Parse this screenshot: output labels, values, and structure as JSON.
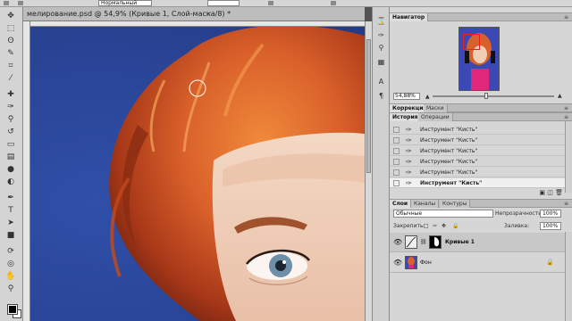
{
  "options_bar": {
    "mode_value": "Нормальный"
  },
  "document": {
    "tab_title": "мелирование.psd @ 54,9% (Кривые 1, Слой-маска/8) *",
    "close_glyph": "×"
  },
  "toolbar": {
    "tools": [
      "move-icon",
      "marquee-icon",
      "lasso-icon",
      "quick-select-icon",
      "crop-icon",
      "eyedropper-icon",
      "healing-icon",
      "brush-icon",
      "stamp-icon",
      "history-brush-icon",
      "eraser-icon",
      "gradient-icon",
      "blur-icon",
      "dodge-icon",
      "pen-icon",
      "type-icon",
      "path-select-icon",
      "shape-icon",
      "3d-rotate-icon",
      "3d-orbit-icon",
      "hand-icon",
      "zoom-icon"
    ],
    "fg_color": "#000000",
    "bg_color": "#ffffff"
  },
  "navigator": {
    "tab": "Навигатор",
    "zoom": "54,88%"
  },
  "adjustments": {
    "tabs": [
      "Коррекция",
      "Маски"
    ]
  },
  "history": {
    "tabs": [
      "История",
      "Операции"
    ],
    "items": [
      "Инструмент \"Кисть\"",
      "Инструмент \"Кисть\"",
      "Инструмент \"Кисть\"",
      "Инструмент \"Кисть\"",
      "Инструмент \"Кисть\"",
      "Инструмент \"Кисть\""
    ]
  },
  "layers": {
    "tabs": [
      "Слои",
      "Каналы",
      "Контуры"
    ],
    "blend_mode": "Обычные",
    "opacity_label": "Непрозрачность:",
    "opacity_value": "100%",
    "lock_label": "Закрепить:",
    "fill_label": "Заливка:",
    "fill_value": "100%",
    "items": [
      {
        "name": "Кривые 1"
      },
      {
        "name": "Фон"
      }
    ]
  },
  "colors": {
    "panel_bg": "#d6d6d6",
    "canvas_blue": "#2a4597",
    "hair": "#d9602a",
    "selection_red": "#e82020"
  }
}
